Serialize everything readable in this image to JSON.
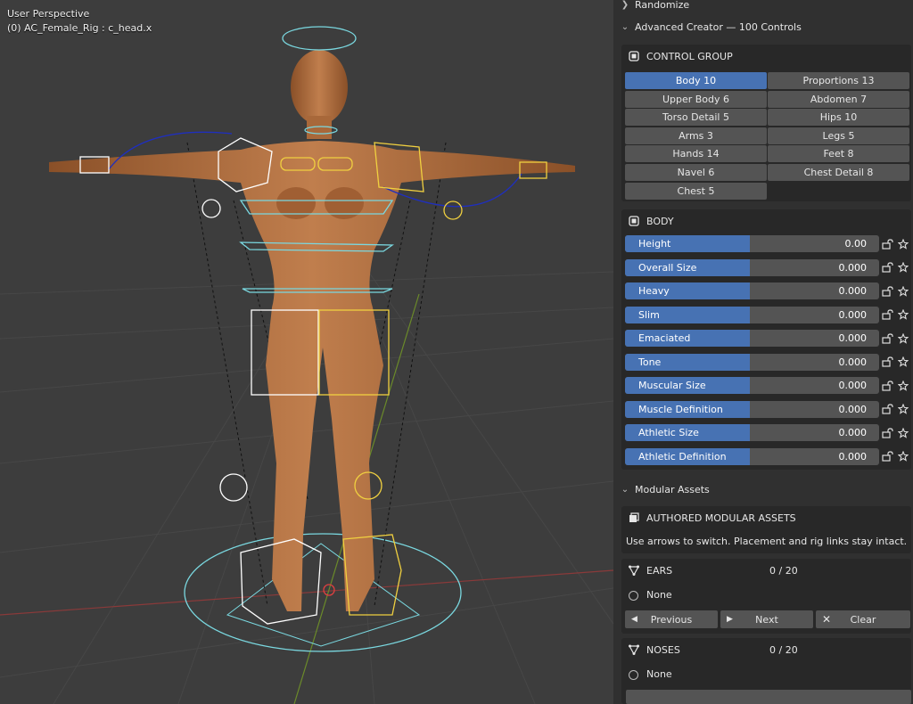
{
  "viewport": {
    "line1": "User Perspective",
    "line2": "(0) AC_Female_Rig : c_head.x"
  },
  "sections": {
    "randomize": "Randomize",
    "advanced_creator": "Advanced Creator — 100 Controls",
    "modular_assets": "Modular Assets"
  },
  "control_group": {
    "title": "CONTROL GROUP",
    "buttons": [
      {
        "label": "Body  10",
        "active": true
      },
      {
        "label": "Proportions  13",
        "active": false
      },
      {
        "label": "Upper Body  6",
        "active": false
      },
      {
        "label": "Abdomen  7",
        "active": false
      },
      {
        "label": "Torso Detail  5",
        "active": false
      },
      {
        "label": "Hips  10",
        "active": false
      },
      {
        "label": "Arms  3",
        "active": false
      },
      {
        "label": "Legs  5",
        "active": false
      },
      {
        "label": "Hands  14",
        "active": false
      },
      {
        "label": "Feet  8",
        "active": false
      },
      {
        "label": "Navel  6",
        "active": false
      },
      {
        "label": "Chest Detail  8",
        "active": false
      },
      {
        "label": "Chest  5",
        "active": false
      }
    ]
  },
  "body": {
    "title": "BODY",
    "sliders": [
      {
        "label": "Height",
        "value": "0.00"
      },
      {
        "label": "Overall Size",
        "value": "0.000"
      },
      {
        "label": "Heavy",
        "value": "0.000"
      },
      {
        "label": "Slim",
        "value": "0.000"
      },
      {
        "label": "Emaciated",
        "value": "0.000"
      },
      {
        "label": "Tone",
        "value": "0.000"
      },
      {
        "label": "Muscular Size",
        "value": "0.000"
      },
      {
        "label": "Muscle Definition",
        "value": "0.000"
      },
      {
        "label": "Athletic Size",
        "value": "0.000"
      },
      {
        "label": "Athletic Definition",
        "value": "0.000"
      }
    ]
  },
  "authored": {
    "title": "AUTHORED MODULAR ASSETS",
    "hint": "Use arrows to switch. Placement and rig links stay intact."
  },
  "ears": {
    "title": "EARS",
    "count": "0 / 20",
    "current": "None",
    "previous": "Previous",
    "next": "Next",
    "clear": "Clear"
  },
  "noses": {
    "title": "NOSES",
    "count": "0 / 20",
    "current": "None"
  },
  "colors": {
    "accent": "#4772b3",
    "button": "#545454",
    "panel": "#282828",
    "background": "#303030",
    "skin": "#b87445"
  }
}
